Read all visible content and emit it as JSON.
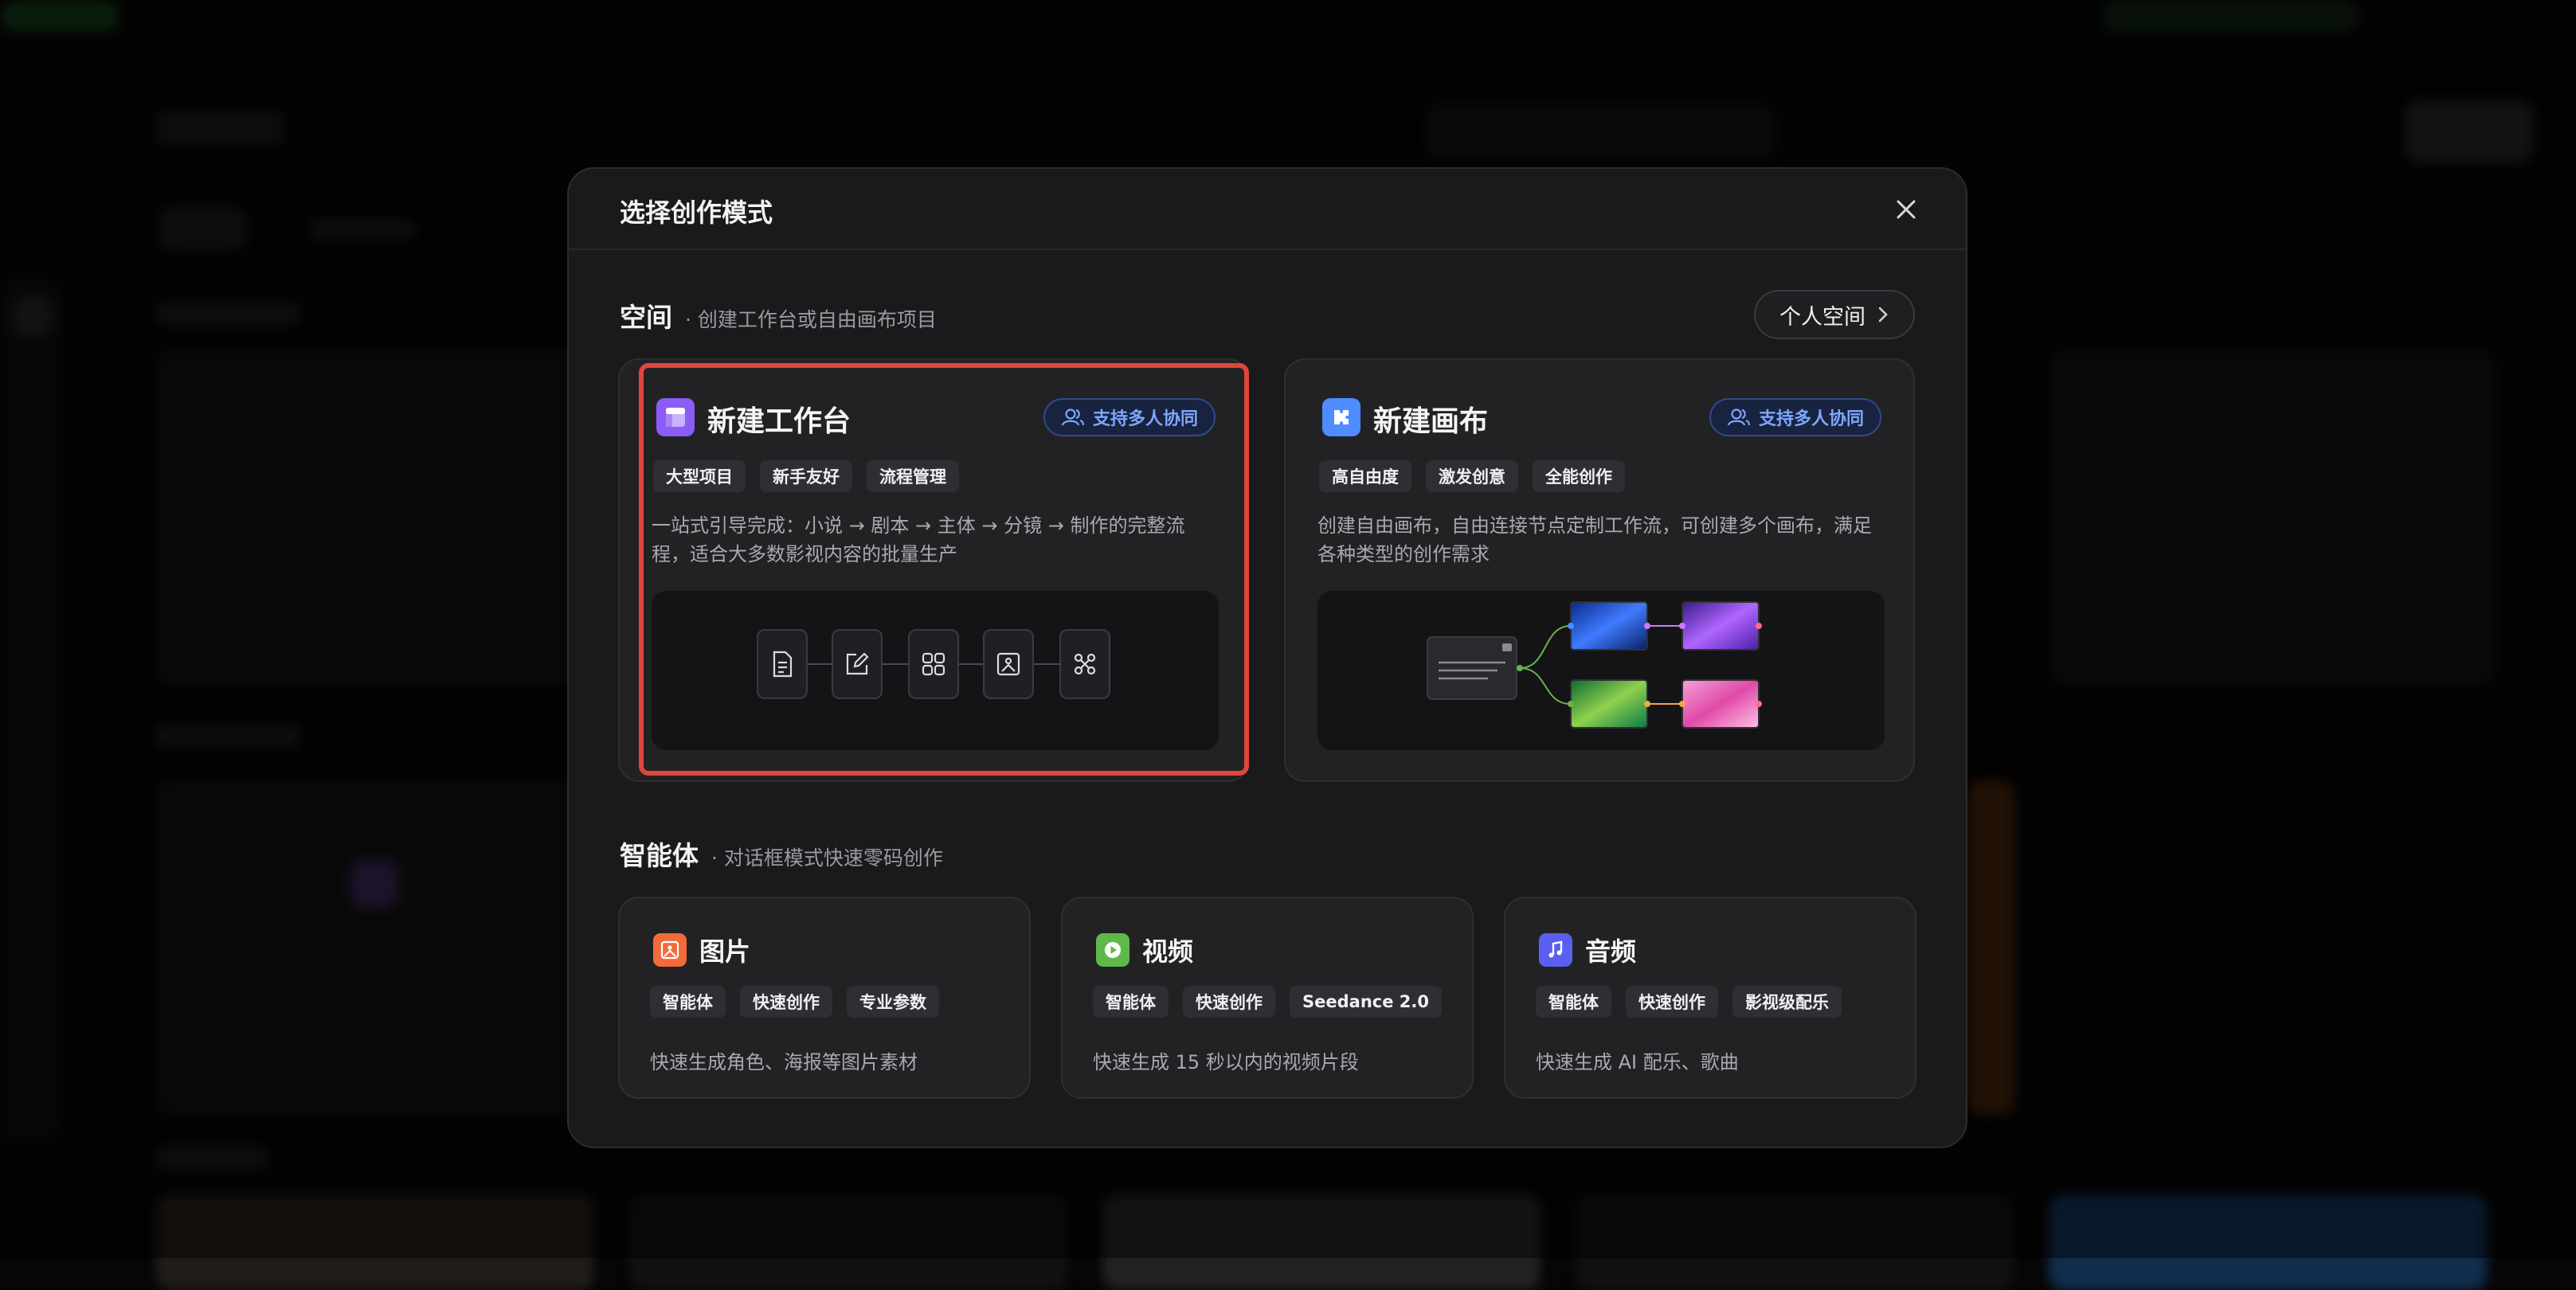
{
  "modal": {
    "title": "选择创作模式",
    "close_icon": "close-icon"
  },
  "space": {
    "title": "空间",
    "subtitle": "· 创建工作台或自由画布项目",
    "personal_button": "个人空间"
  },
  "workbench": {
    "title": "新建工作台",
    "badge": "支持多人协同",
    "tags": [
      "大型项目",
      "新手友好",
      "流程管理"
    ],
    "desc_line1": "一站式引导完成：小说 → 剧本 → 主体 → 分镜 → 制作的完整流",
    "desc_line2": "程，适合大多数影视内容的批量生产",
    "flow_icons": [
      "document-icon",
      "edit-icon",
      "grid-icon",
      "image-icon",
      "cut-icon"
    ],
    "accent": "#8b5cf6",
    "selected": true
  },
  "canvas": {
    "title": "新建画布",
    "badge": "支持多人协同",
    "tags": [
      "高自由度",
      "激发创意",
      "全能创作"
    ],
    "desc_line1": "创建自由画布，自由连接节点定制工作流，可创建多个画布，满足",
    "desc_line2": "各种类型的创作需求",
    "accent": "#4f8cff"
  },
  "agents": {
    "title": "智能体",
    "subtitle": "· 对话框模式快速零码创作",
    "items": [
      {
        "title": "图片",
        "icon": "image-icon",
        "tags": [
          "智能体",
          "快速创作",
          "专业参数"
        ],
        "desc": "快速生成角色、海报等图片素材",
        "color": "#f26b3a"
      },
      {
        "title": "视频",
        "icon": "play-icon",
        "tags": [
          "智能体",
          "快速创作",
          "Seedance 2.0"
        ],
        "desc": "快速生成 15 秒以内的视频片段",
        "color": "#5fb94a"
      },
      {
        "title": "音频",
        "icon": "music-note-icon",
        "tags": [
          "智能体",
          "快速创作",
          "影视级配乐"
        ],
        "desc": "快速生成 AI 配乐、歌曲",
        "color": "#5b5ff0"
      }
    ]
  },
  "colors": {
    "badge_text": "#7fa6ff",
    "highlight_border": "#e0463c",
    "modal_bg": "#1a1a1c"
  }
}
